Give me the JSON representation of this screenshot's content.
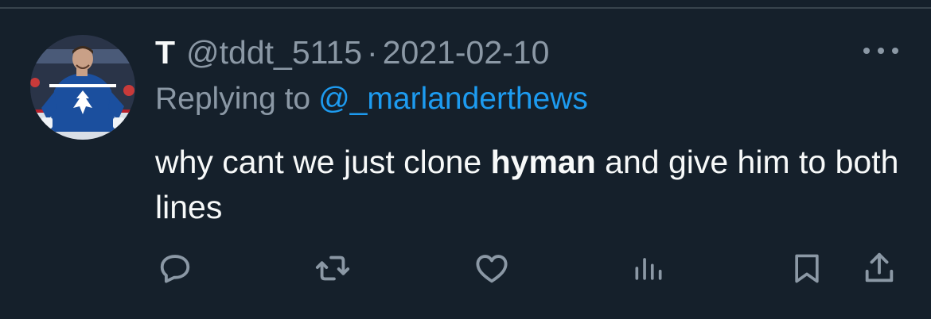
{
  "tweet": {
    "display_name": "T",
    "handle": "@tddt_5115",
    "separator": "·",
    "date": "2021-02-10",
    "replying_to_label": "Replying to",
    "replying_to_handle": "@_marlanderthews",
    "text_before": "why cant we just clone ",
    "text_bold": "hyman",
    "text_after": " and give him to both lines"
  },
  "colors": {
    "background": "#15202b",
    "text": "#f7f9f9",
    "secondary_text": "#8b98a5",
    "link": "#1d9bf0",
    "divider": "#38444d"
  },
  "icons": {
    "more": "more-horizontal-icon",
    "reply": "reply-icon",
    "retweet": "retweet-icon",
    "like": "heart-icon",
    "views": "analytics-icon",
    "bookmark": "bookmark-icon",
    "share": "share-icon"
  }
}
